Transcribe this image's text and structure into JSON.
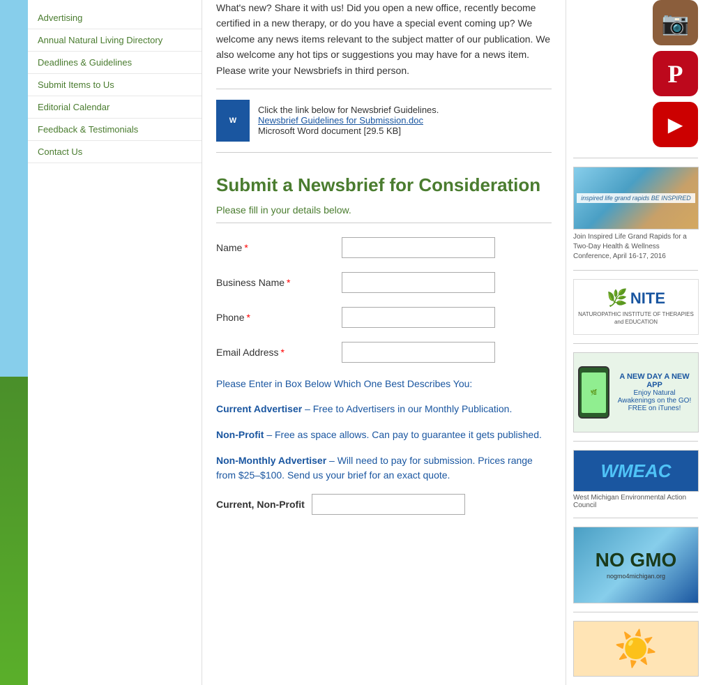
{
  "sidebar": {
    "items": [
      {
        "id": "advertising",
        "label": "Advertising"
      },
      {
        "id": "annual-natural-living-directory",
        "label": "Annual Natural Living Directory"
      },
      {
        "id": "deadlines-guidelines",
        "label": "Deadlines & Guidelines"
      },
      {
        "id": "submit-items",
        "label": "Submit Items to Us"
      },
      {
        "id": "editorial-calendar",
        "label": "Editorial Calendar"
      },
      {
        "id": "feedback-testimonials",
        "label": "Feedback & Testimonials"
      },
      {
        "id": "contact-us",
        "label": "Contact Us"
      }
    ]
  },
  "intro": {
    "text": "What's new? Share it with us! Did you open a new office, recently become certified in a new therapy, or do you have a special event coming up? We welcome any news items relevant to the subject matter of our publication. We also welcome any hot tips or suggestions you may have for a news item. Please write your Newsbriefs in third person."
  },
  "doc_link": {
    "prompt": "Click the link below for Newsbrief Guidelines.",
    "link_text": "Newsbrief Guidelines for Submission.doc",
    "file_info": "Microsoft Word document [29.5 KB]"
  },
  "form": {
    "title": "Submit a Newsbrief for Consideration",
    "subtitle": "Please fill in your details below.",
    "fields": [
      {
        "id": "name",
        "label": "Name",
        "required": true,
        "placeholder": ""
      },
      {
        "id": "business-name",
        "label": "Business Name",
        "required": true,
        "placeholder": ""
      },
      {
        "id": "phone",
        "label": "Phone",
        "required": true,
        "placeholder": ""
      },
      {
        "id": "email",
        "label": "Email Address",
        "required": true,
        "placeholder": ""
      }
    ],
    "describe_prompt": "Please Enter in Box Below Which One Best Describes You:",
    "options": [
      {
        "id": "current-advertiser",
        "name": "Current Advertiser",
        "description": "– Free to Advertisers in our Monthly Publication."
      },
      {
        "id": "non-profit",
        "name": "Non-Profit",
        "description": "– Free as space allows. Can pay to guarantee it gets published."
      },
      {
        "id": "non-monthly-advertiser",
        "name": "Non-Monthly Advertiser",
        "description": "– Will need to pay for submission. Prices range from $25–$100. Send us your brief for an exact quote."
      }
    ],
    "current_label": "Current, Non-Profit"
  },
  "right_sidebar": {
    "social": [
      {
        "id": "instagram",
        "icon": "📷",
        "label": "Instagram"
      },
      {
        "id": "pinterest",
        "icon": "P",
        "label": "Pinterest"
      },
      {
        "id": "youtube",
        "icon": "▶",
        "label": "YouTube"
      }
    ],
    "ads": [
      {
        "id": "inspired-life",
        "title": "Inspired Life Grand Rapids",
        "caption": "Join Inspired Life Grand Rapids for a Two-Day Health & Wellness Conference, April 16-17, 2016"
      },
      {
        "id": "nite",
        "title": "NITE",
        "subtitle": "NATUROPATHIC INSTITUTE OF THERAPIES and EDUCATION"
      },
      {
        "id": "natural-awakenings-app",
        "title": "A NEW DAY A NEW APP",
        "body": "Enjoy Natural Awakenings on the GO! FREE on iTunes!"
      },
      {
        "id": "wmeac",
        "title": "WMEAC",
        "subtitle": "West Michigan Environmental Action Council"
      },
      {
        "id": "nogmo",
        "title": "NO GMO",
        "subtitle": "nogmo4michigan.org"
      },
      {
        "id": "sun-ad",
        "title": "Sun Ad"
      }
    ]
  }
}
